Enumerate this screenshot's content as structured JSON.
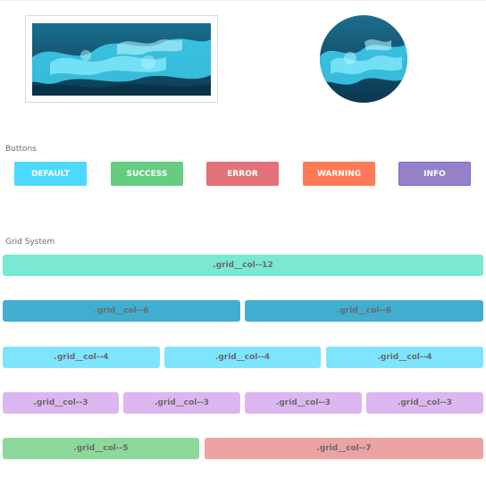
{
  "sections": {
    "buttons_label": "Buttons",
    "grid_label": "Grid System"
  },
  "images": {
    "thumbnail_icon": "ocean-wave-image",
    "circle_icon": "ocean-wave-image"
  },
  "buttons": [
    {
      "label": "DEFAULT",
      "color": "#4dd8ff"
    },
    {
      "label": "SUCCESS",
      "color": "#66cc80"
    },
    {
      "label": "ERROR",
      "color": "#e3717a"
    },
    {
      "label": "WARNING",
      "color": "#ff7b57"
    },
    {
      "label": "INFO",
      "color": "#9580c9"
    }
  ],
  "grid": [
    {
      "cols": [
        {
          "label": ".grid__col--12",
          "color": "#7ae8d3"
        }
      ]
    },
    {
      "cols": [
        {
          "label": ".grid__col--6",
          "color": "#41aed0"
        },
        {
          "label": ".grid__col--6",
          "color": "#41aed0"
        }
      ]
    },
    {
      "cols": [
        {
          "label": ".grid__col--4",
          "color": "#7ee5fd"
        },
        {
          "label": ".grid__col--4",
          "color": "#7ee5fd"
        },
        {
          "label": ".grid__col--4",
          "color": "#7ee5fd"
        }
      ]
    },
    {
      "cols": [
        {
          "label": ".grid__col--3",
          "color": "#dcb6ef"
        },
        {
          "label": ".grid__col--3",
          "color": "#dcb6ef"
        },
        {
          "label": ".grid__col--3",
          "color": "#dcb6ef"
        },
        {
          "label": ".grid__col--3",
          "color": "#dcb6ef"
        }
      ]
    },
    {
      "cols": [
        {
          "label": ".grid__col--5",
          "color": "#8dd99b"
        },
        {
          "label": ".grid__col--7",
          "color": "#eca3a3"
        }
      ]
    }
  ]
}
